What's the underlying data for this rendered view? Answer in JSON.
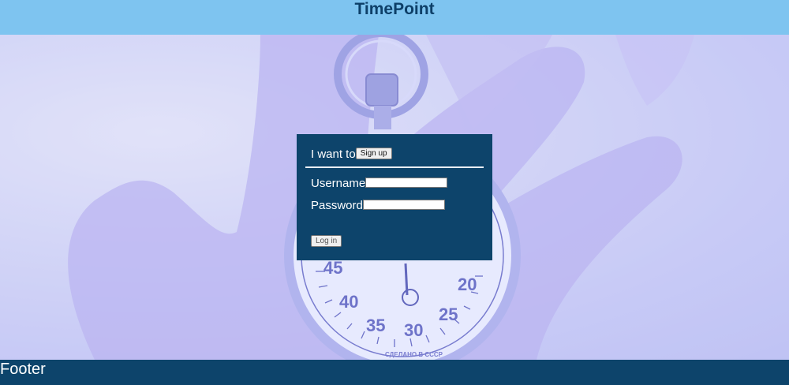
{
  "header": {
    "title": "TimePoint"
  },
  "panel": {
    "intro_text": "I want to",
    "signup_label": "Sign up",
    "username_label": "Username",
    "username_value": "",
    "password_label": "Password",
    "password_value": "",
    "login_label": "Log in"
  },
  "footer": {
    "text": "Footer"
  },
  "background_image": {
    "dial_numbers": [
      "45",
      "40",
      "35",
      "30",
      "25",
      "20"
    ],
    "dial_inscription": "СДЕЛАНО В СССР"
  },
  "colors": {
    "header_bg": "#7ec4f0",
    "header_text": "#0d3f68",
    "panel_bg": "#0d446b",
    "footer_bg": "#0d446b"
  }
}
